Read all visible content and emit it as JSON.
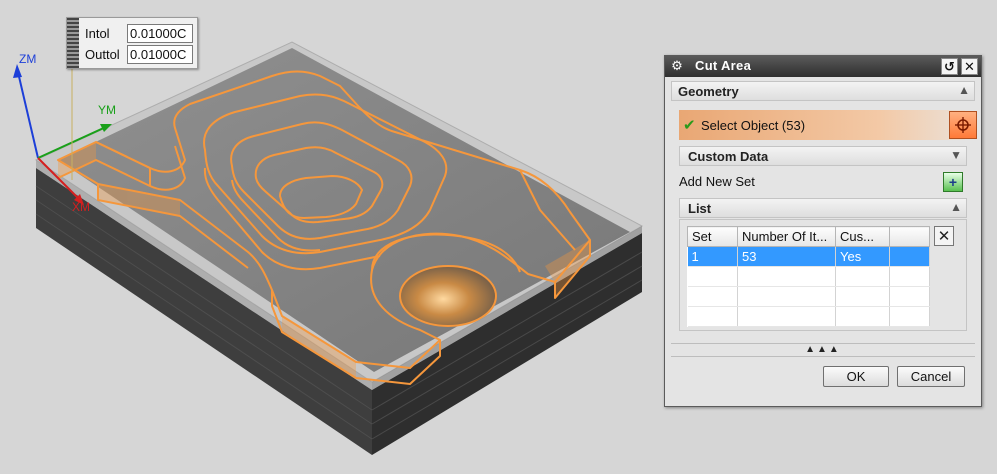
{
  "tolerance": {
    "intol_label": "Intol",
    "intol_value": "0.01000C",
    "outtol_label": "Outtol",
    "outtol_value": "0.01000C"
  },
  "axes": {
    "zm": "ZM",
    "ym": "YM",
    "xm": "XM"
  },
  "dialog": {
    "title": "Cut Area",
    "geometry_label": "Geometry",
    "select_object_label": "Select Object (53)",
    "custom_data_label": "Custom Data",
    "add_new_set_label": "Add New Set",
    "list_label": "List",
    "table": {
      "columns": [
        "Set",
        "Number Of It...",
        "Cus..."
      ],
      "rows": [
        {
          "set": "1",
          "count": "53",
          "custom": "Yes"
        }
      ]
    },
    "ok_label": "OK",
    "cancel_label": "Cancel"
  },
  "colors": {
    "highlight_edges": "#f5973c",
    "block_top": "#7a7a7a",
    "block_side": "#3c3c3c",
    "selected_row": "#3399ff"
  },
  "icons": {
    "dialog_settings": "gear-icon",
    "reset": "reset-icon",
    "close": "close-icon",
    "select_object": "crosshair-icon",
    "add_set": "add-icon",
    "delete": "delete-icon"
  }
}
